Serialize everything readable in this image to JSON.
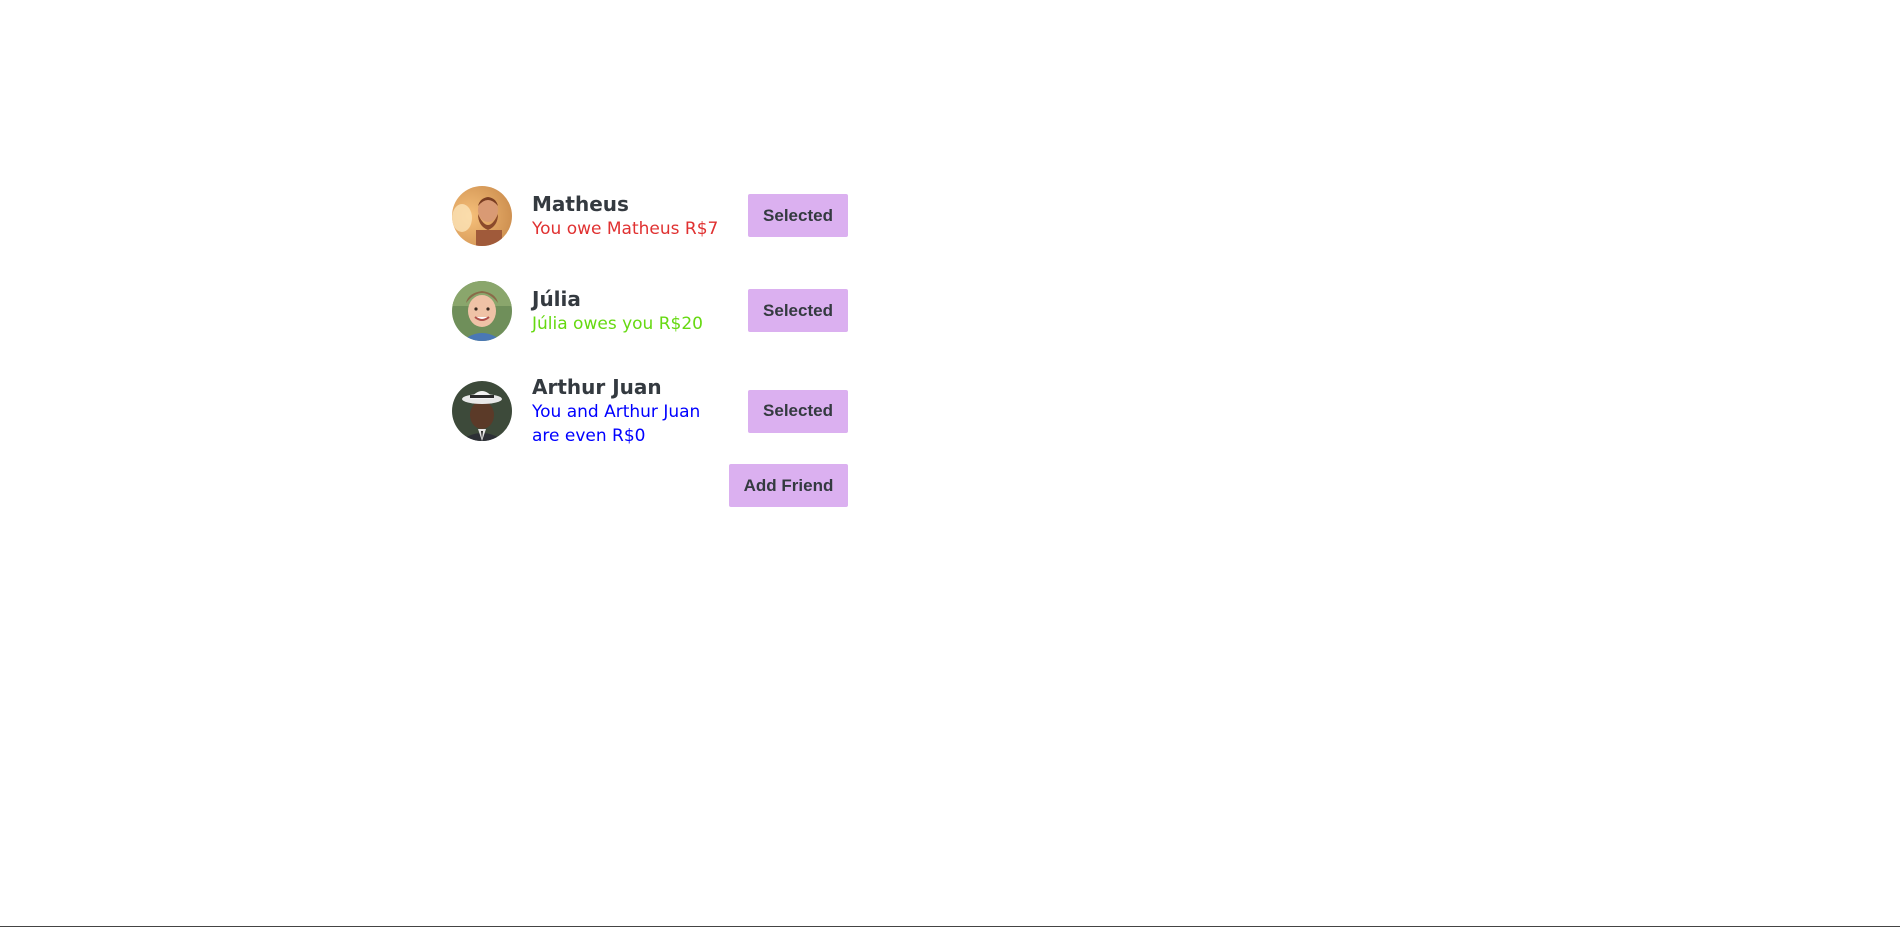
{
  "friends": [
    {
      "name": "Matheus",
      "status": "You owe Matheus R$7",
      "status_kind": "owe",
      "button_label": "Selected",
      "avatar": "bearded-man-photo"
    },
    {
      "name": "Júlia",
      "status": "Júlia owes you R$20",
      "status_kind": "owed",
      "button_label": "Selected",
      "avatar": "smiling-child-photo"
    },
    {
      "name": "Arthur Juan",
      "status": "You and Arthur Juan are even R$0",
      "status_kind": "even",
      "button_label": "Selected",
      "avatar": "man-in-hat-photo"
    }
  ],
  "add_friend_label": "Add Friend",
  "colors": {
    "button_bg": "#dbb0f0",
    "name_text": "#343a40",
    "owe": "#e03131",
    "owed": "#66d911",
    "even": "#0000ff"
  }
}
